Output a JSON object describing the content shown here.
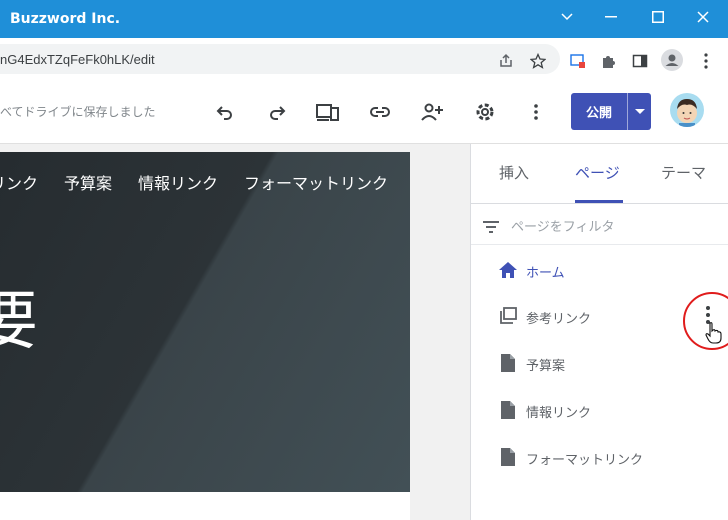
{
  "window": {
    "title": "Buzzword Inc.",
    "controls": [
      "chevron-down-icon",
      "minimize-icon",
      "maximize-icon",
      "close-icon"
    ]
  },
  "address_bar": {
    "url": "nG4EdxTZqFeFk0hLK/edit",
    "icons": [
      "share-icon",
      "star-icon",
      "extension-badge-icon",
      "puzzle-icon",
      "sidepanel-icon",
      "profile-icon",
      "kebab-menu-icon"
    ]
  },
  "toolbar": {
    "saved_status": "べてドライブに保存しました",
    "icons": [
      "undo-icon",
      "redo-icon",
      "preview-devices-icon",
      "link-icon",
      "add-user-icon",
      "settings-icon",
      "more-vert-icon"
    ],
    "publish_label": "公開"
  },
  "canvas": {
    "nav_items": [
      "リンク",
      "予算案",
      "情報リンク",
      "フォーマットリンク"
    ],
    "hero_title": "要"
  },
  "panel": {
    "tabs": [
      {
        "label": "挿入",
        "active": false
      },
      {
        "label": "ページ",
        "active": true
      },
      {
        "label": "テーマ",
        "active": false
      }
    ],
    "filter_placeholder": "ページをフィルタ",
    "pages": [
      {
        "label": "ホーム",
        "icon": "home-icon",
        "selected": true
      },
      {
        "label": "参考リンク",
        "icon": "page-group-icon",
        "selected": false
      },
      {
        "label": "予算案",
        "icon": "page-icon",
        "selected": false
      },
      {
        "label": "情報リンク",
        "icon": "page-icon",
        "selected": false
      },
      {
        "label": "フォーマットリンク",
        "icon": "page-icon",
        "selected": false
      }
    ]
  },
  "colors": {
    "titlebar": "#1f8fd8",
    "accent": "#3f51b5",
    "highlight": "#e01c1c"
  }
}
